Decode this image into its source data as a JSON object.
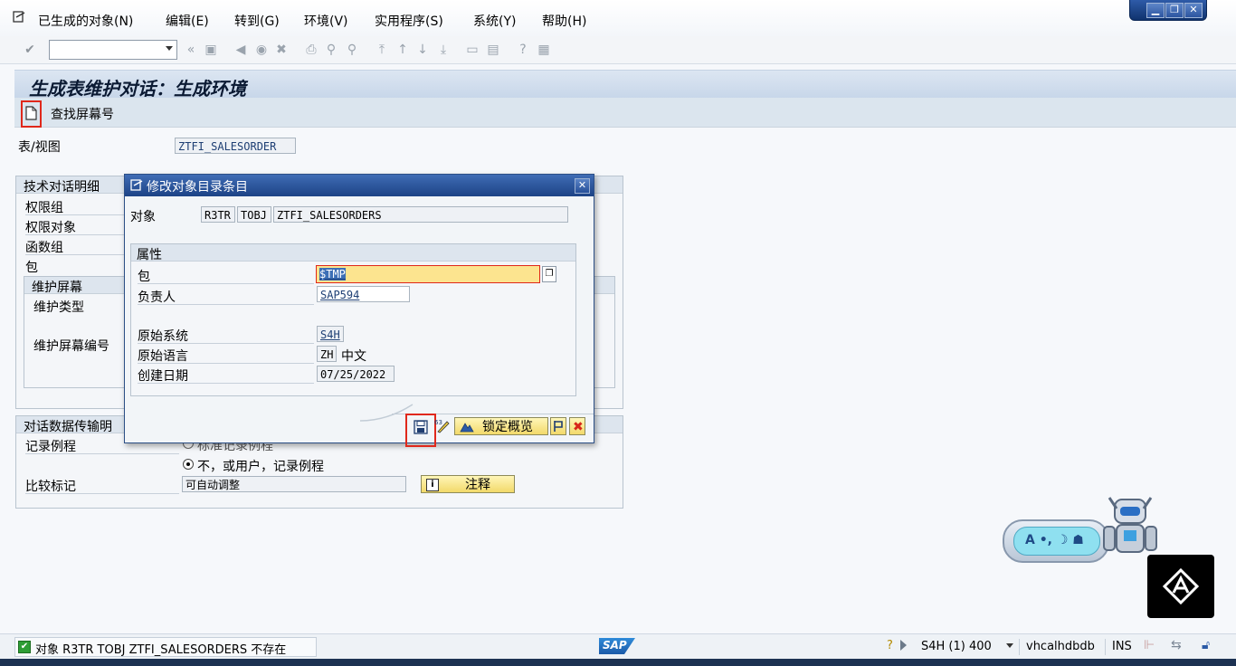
{
  "menubar": {
    "items": [
      "已生成的对象(N)",
      "编辑(E)",
      "转到(G)",
      "环境(V)",
      "实用程序(S)",
      "系统(Y)",
      "帮助(H)"
    ]
  },
  "page": {
    "title": "生成表维护对话：生成环境",
    "find_screen_label": "查找屏幕号"
  },
  "main": {
    "table_view_label": "表/视图",
    "table_view_value": "ZTFI_SALESORDER",
    "tech_group": {
      "header": "技术对话明细",
      "auth_group_label": "权限组",
      "auth_object_label": "权限对象",
      "function_group_label": "函数组",
      "package_label": "包"
    },
    "maint_screen": {
      "header": "维护屏幕",
      "type_label": "维护类型",
      "number_label": "维护屏幕编号"
    },
    "transport_group": {
      "header": "对话数据传输明",
      "record_routine_label": "记录例程",
      "radio_standard_label": "标准记录例程",
      "radio_no_label": "不，或用户，记录例程",
      "compare_flag_label": "比较标记",
      "compare_flag_value": "可自动调整",
      "notes_button_label": "注释"
    }
  },
  "dialog": {
    "title": "修改对象目录条目",
    "object_label": "对象",
    "object_pgmid": "R3TR",
    "object_type": "TOBJ",
    "object_name": "ZTFI_SALESORDERS",
    "attributes_header": "属性",
    "package_label": "包",
    "package_value": "$TMP",
    "owner_label": "负责人",
    "owner_value": "SAP594",
    "orig_system_label": "原始系统",
    "orig_system_value": "S4H",
    "orig_language_label": "原始语言",
    "orig_language_code": "ZH",
    "orig_language_name": "中文",
    "created_on_label": "创建日期",
    "created_on_value": "07/25/2022",
    "lock_overview_label": "锁定概览"
  },
  "status": {
    "message": "对象 R3TR TOBJ ZTFI_SALESORDERS 不存在",
    "system": "S4H (1) 400",
    "server": "vhcalhdbdb",
    "mode": "INS",
    "sap_logo_text": "SAP"
  },
  "widget": {
    "text": "A •, ☽ ☗"
  },
  "colors": {
    "accent_blue": "#1d4386",
    "highlight_red": "#e0281b",
    "field_yellow": "#fce48f",
    "button_yellow": "#f2d96a"
  }
}
